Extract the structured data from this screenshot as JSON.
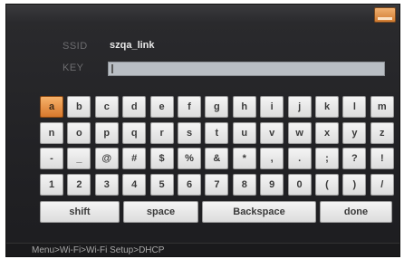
{
  "form": {
    "ssid_label": "SSID",
    "ssid_value": "szqa_link",
    "key_label": "KEY",
    "key_value": ""
  },
  "keyboard": {
    "selected_key": "a",
    "rows": [
      [
        "a",
        "b",
        "c",
        "d",
        "e",
        "f",
        "g",
        "h",
        "i",
        "j",
        "k",
        "l",
        "m"
      ],
      [
        "n",
        "o",
        "p",
        "q",
        "r",
        "s",
        "t",
        "u",
        "v",
        "w",
        "x",
        "y",
        "z"
      ],
      [
        "-",
        "_",
        "@",
        "#",
        "$",
        "%",
        "&",
        "*",
        ",",
        ".",
        ";",
        "?",
        "!"
      ],
      [
        "1",
        "2",
        "3",
        "4",
        "5",
        "6",
        "7",
        "8",
        "9",
        "0",
        "(",
        ")",
        "/"
      ]
    ],
    "actions": {
      "shift": "shift",
      "space": "space",
      "backspace": "Backspace",
      "done": "done"
    }
  },
  "status": {
    "breadcrumb": "Menu>Wi-Fi>Wi-Fi Setup>DHCP"
  },
  "colors": {
    "selected_key": "#e08a3c",
    "screen_bg": "#252528"
  },
  "icons": {
    "corner": "menu-icon"
  }
}
